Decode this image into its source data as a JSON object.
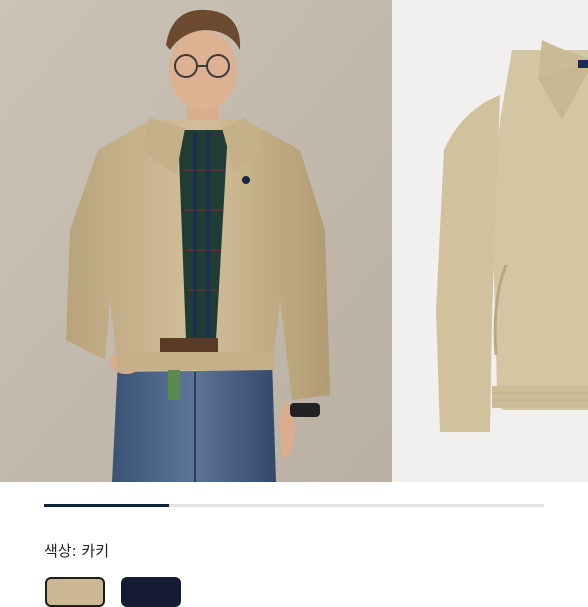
{
  "product": {
    "color_label": "색상: 카키",
    "gallery_progress": 0.25,
    "images": [
      {
        "name": "model-wearing-jacket"
      },
      {
        "name": "jacket-flat-view"
      }
    ],
    "swatches": [
      {
        "name": "khaki",
        "color": "#cdb894",
        "selected": true
      },
      {
        "name": "navy",
        "color": "#141c33",
        "selected": false
      }
    ]
  },
  "colors": {
    "progress_track": "#e3e3e3",
    "progress_fill": "#0f2238"
  }
}
